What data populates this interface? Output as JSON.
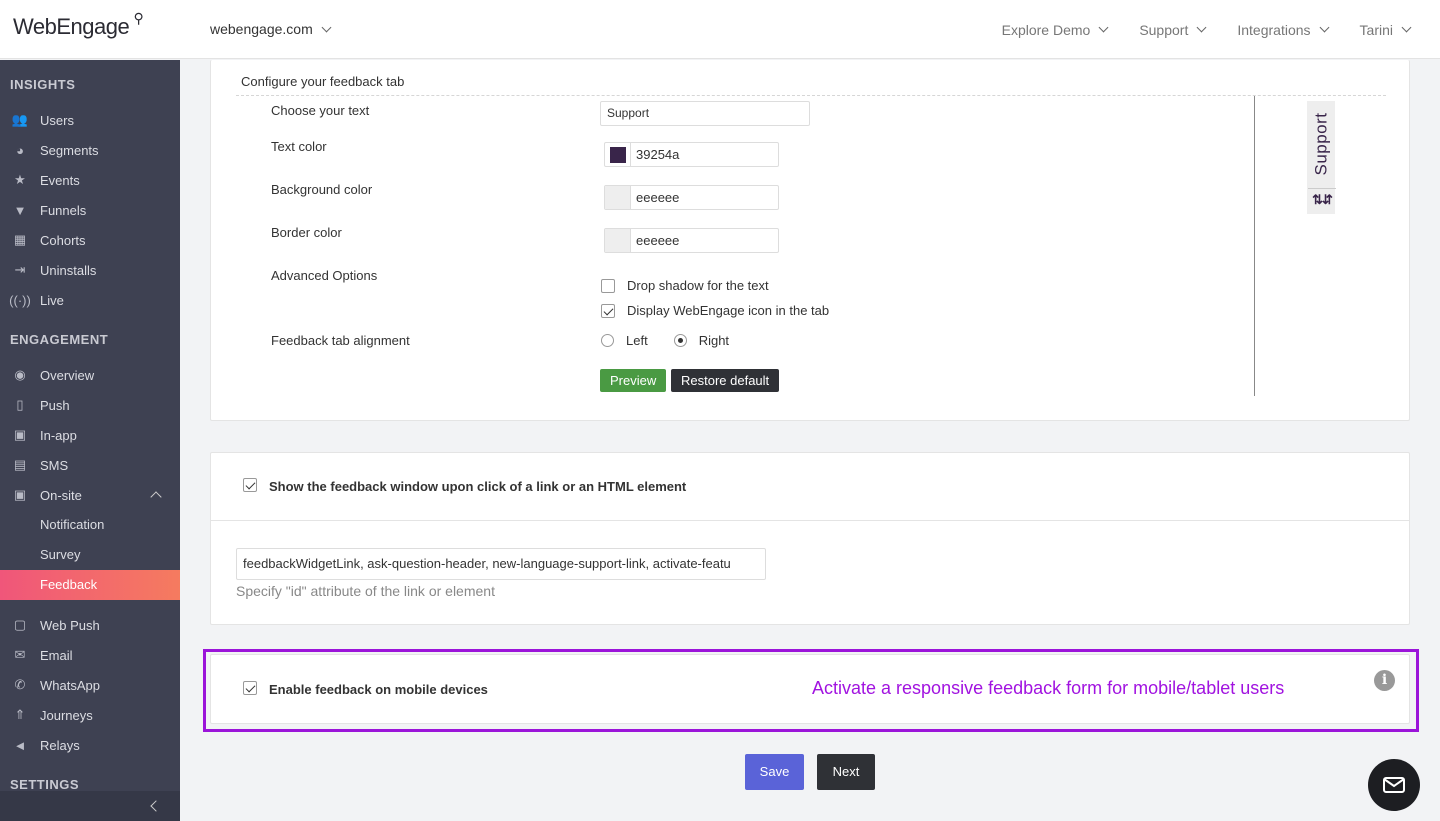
{
  "header": {
    "logo": "WebEngage",
    "site": "webengage.com",
    "nav": [
      "Explore Demo",
      "Support",
      "Integrations",
      "Tarini"
    ]
  },
  "sidebar": {
    "insights_title": "INSIGHTS",
    "insights": [
      {
        "label": "Users",
        "icon": "users-icon"
      },
      {
        "label": "Segments",
        "icon": "pie-icon"
      },
      {
        "label": "Events",
        "icon": "star-icon"
      },
      {
        "label": "Funnels",
        "icon": "funnel-icon"
      },
      {
        "label": "Cohorts",
        "icon": "grid-icon"
      },
      {
        "label": "Uninstalls",
        "icon": "exit-icon"
      },
      {
        "label": "Live",
        "icon": "broadcast-icon"
      }
    ],
    "engagement_title": "ENGAGEMENT",
    "engagement": [
      {
        "label": "Overview",
        "icon": "eye-icon"
      },
      {
        "label": "Push",
        "icon": "mobile-icon"
      },
      {
        "label": "In-app",
        "icon": "phone-icon"
      },
      {
        "label": "SMS",
        "icon": "chat-icon"
      },
      {
        "label": "On-site",
        "icon": "onsite-icon"
      }
    ],
    "onsite_sub": [
      "Notification",
      "Survey",
      "Feedback"
    ],
    "engagement2": [
      {
        "label": "Web Push",
        "icon": "browser-icon"
      },
      {
        "label": "Email",
        "icon": "mail-icon"
      },
      {
        "label": "WhatsApp",
        "icon": "whatsapp-icon"
      },
      {
        "label": "Journeys",
        "icon": "rocket-icon"
      },
      {
        "label": "Relays",
        "icon": "megaphone-icon"
      }
    ],
    "settings_title": "SETTINGS"
  },
  "config": {
    "title": "Configure your feedback tab",
    "choose_text_label": "Choose your text",
    "choose_text_value": "Support",
    "text_color_label": "Text color",
    "text_color": "39254a",
    "text_color_hex": "#39254a",
    "bg_color_label": "Background color",
    "bg_color": "eeeeee",
    "bg_color_hex": "#eeeeee",
    "border_color_label": "Border color",
    "border_color": "eeeeee",
    "border_color_hex": "#eeeeee",
    "advanced_label": "Advanced Options",
    "drop_shadow": "Drop shadow for the text",
    "display_icon": "Display WebEngage icon in the tab",
    "alignment_label": "Feedback tab alignment",
    "align_left": "Left",
    "align_right": "Right",
    "preview_btn": "Preview",
    "restore_btn": "Restore default",
    "preview_tab_text": "Support"
  },
  "link_section": {
    "label": "Show the feedback window upon click of a link or an HTML element",
    "ids_value": "feedbackWidgetLink, ask-question-header, new-language-support-link, activate-featu",
    "hint": "Specify \"id\" attribute of the link or element"
  },
  "mobile_section": {
    "label": "Enable feedback on mobile devices",
    "annotation": "Activate a responsive feedback form for mobile/tablet users"
  },
  "actions": {
    "save": "Save",
    "next": "Next"
  }
}
